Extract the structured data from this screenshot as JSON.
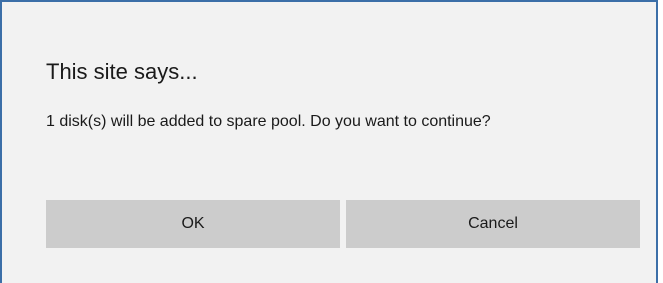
{
  "dialog": {
    "title": "This site says...",
    "message": "1 disk(s) will be added to spare pool. Do you want to continue?",
    "ok_label": "OK",
    "cancel_label": "Cancel"
  },
  "colors": {
    "border_accent": "#3c6fa8",
    "dialog_background": "#f2f2f2",
    "button_background": "#cccccc"
  }
}
